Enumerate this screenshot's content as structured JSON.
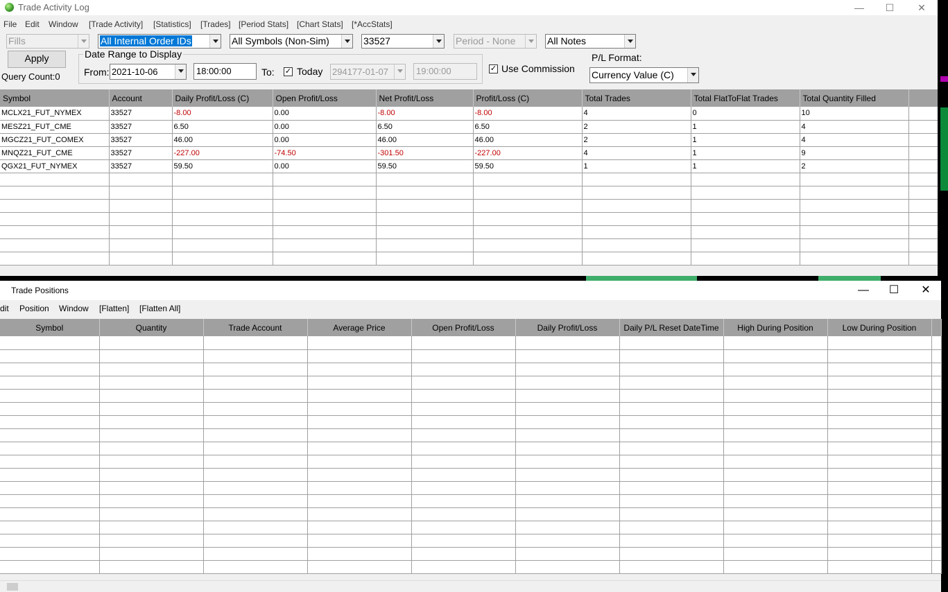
{
  "trade_activity": {
    "title": "Trade Activity Log",
    "menu": [
      "File",
      "Edit",
      "Window",
      "[Trade Activity]",
      "[Statistics]",
      "[Trades]",
      "[Period Stats]",
      "[Chart Stats]",
      "[*AccStats]"
    ],
    "filters": {
      "type": "Fills",
      "order_ids": "All Internal Order IDs",
      "symbols": "All Symbols (Non-Sim)",
      "account": "33527",
      "period": "Period - None",
      "notes": "All Notes"
    },
    "apply_label": "Apply",
    "query_count": "Query Count:0",
    "date_range": {
      "legend": "Date Range to Display",
      "from_label": "From:",
      "from_date": "2021-10-06",
      "from_time": "18:00:00",
      "to_label": "To:",
      "today_label": "Today",
      "today_checked": "✓",
      "to_date": "294177-01-07",
      "to_time": "19:00:00"
    },
    "use_commission_label": "Use Commission",
    "use_commission_checked": "✓",
    "pl_format_label": "P/L Format:",
    "pl_format": "Currency Value (C)",
    "columns": [
      "Symbol",
      "Account",
      "Daily Profit/Loss (C)",
      "Open Profit/Loss",
      "Net Profit/Loss",
      "Profit/Loss (C)",
      "Total Trades",
      "Total FlatToFlat Trades",
      "Total Quantity Filled"
    ],
    "rows": [
      [
        "MCLX21_FUT_NYMEX",
        "33527",
        "-8.00",
        "0.00",
        "-8.00",
        "-8.00",
        "4",
        "0",
        "10"
      ],
      [
        "MESZ21_FUT_CME",
        "33527",
        "6.50",
        "0.00",
        "6.50",
        "6.50",
        "2",
        "1",
        "4"
      ],
      [
        "MGCZ21_FUT_COMEX",
        "33527",
        "46.00",
        "0.00",
        "46.00",
        "46.00",
        "2",
        "1",
        "4"
      ],
      [
        "MNQZ21_FUT_CME",
        "33527",
        "-227.00",
        "-74.50",
        "-301.50",
        "-227.00",
        "4",
        "1",
        "9"
      ],
      [
        "QGX21_FUT_NYMEX",
        "33527",
        "59.50",
        "0.00",
        "59.50",
        "59.50",
        "1",
        "1",
        "2"
      ]
    ],
    "empty_rows": 7
  },
  "trade_positions": {
    "title": "Trade Positions",
    "menu": [
      "dit",
      "Position",
      "Window",
      "[Flatten]",
      "[Flatten All]"
    ],
    "columns": [
      "Symbol",
      "Quantity",
      "Trade Account",
      "Average Price",
      "Open Profit/Loss",
      "Daily Profit/Loss",
      "Daily P/L Reset DateTime",
      "High During Position",
      "Low During Position"
    ],
    "empty_rows": 18
  },
  "window_controls": {
    "minimize": "—",
    "maximize": "☐",
    "close": "✕"
  },
  "colors": {
    "negative": "#c00000",
    "header_bg": "#a0a0a0",
    "selection": "#0078d7"
  }
}
